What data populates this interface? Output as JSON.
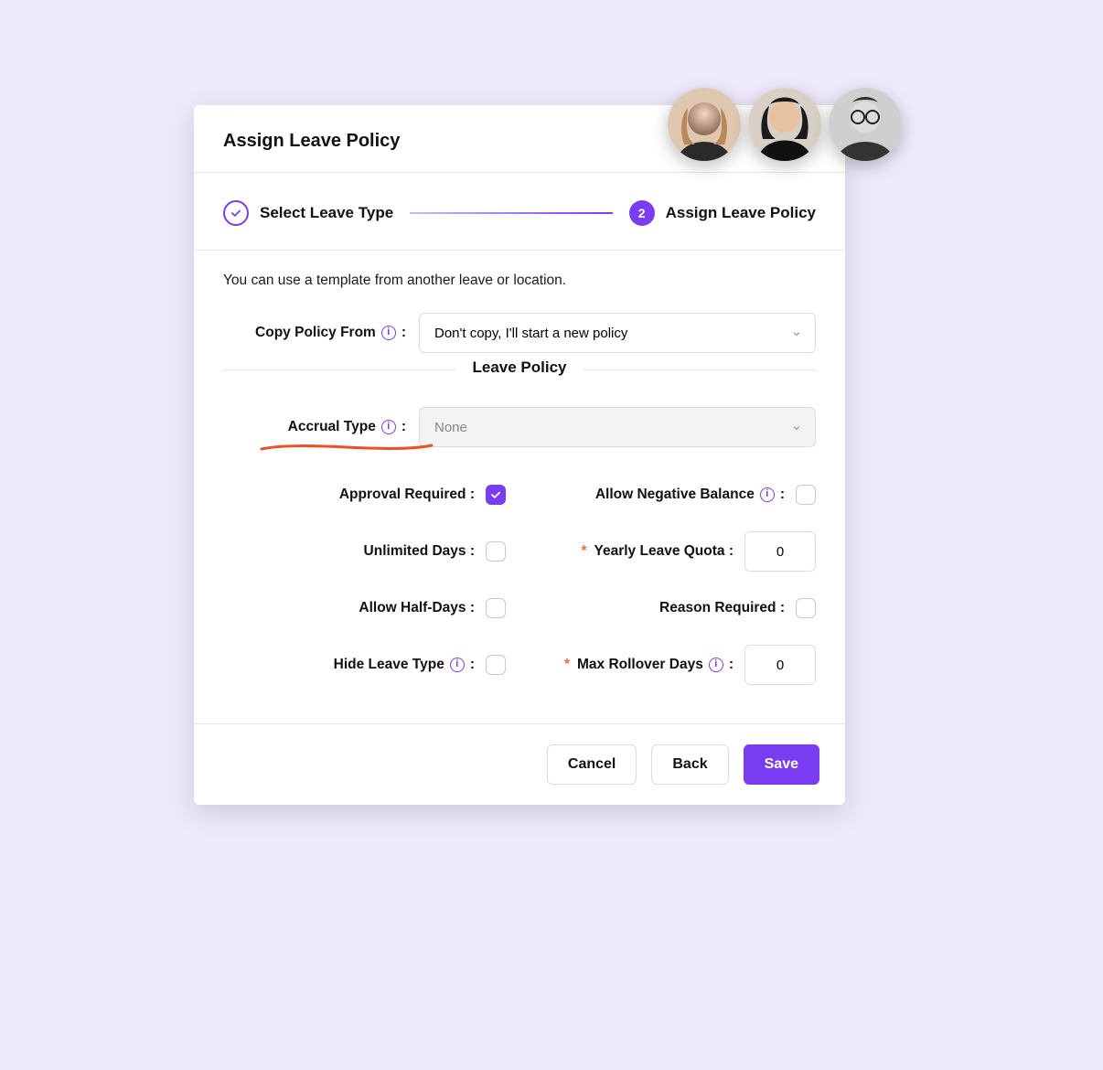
{
  "dialog": {
    "title": "Assign Leave Policy"
  },
  "steps": {
    "step1_label": "Select Leave Type",
    "step2_number": "2",
    "step2_label": "Assign Leave Policy"
  },
  "intro": "You can use a template from another leave or location.",
  "copy_from": {
    "label": "Copy Policy From",
    "value": "Don't copy, I'll start a new policy"
  },
  "section_title": "Leave Policy",
  "accrual": {
    "label": "Accrual Type",
    "value": "None"
  },
  "fields": {
    "approval_required": {
      "label": "Approval Required :",
      "checked": true
    },
    "allow_negative": {
      "label": "Allow Negative Balance",
      "checked": false
    },
    "unlimited_days": {
      "label": "Unlimited Days :",
      "checked": false
    },
    "yearly_quota": {
      "label": "Yearly Leave Quota :",
      "value": "0",
      "required": true
    },
    "allow_half_days": {
      "label": "Allow Half-Days :",
      "checked": false
    },
    "reason_required": {
      "label": "Reason Required :",
      "checked": false
    },
    "hide_leave_type": {
      "label": "Hide Leave Type",
      "checked": false
    },
    "max_rollover": {
      "label": "Max Rollover Days",
      "value": "0",
      "required": true
    }
  },
  "footer": {
    "cancel": "Cancel",
    "back": "Back",
    "save": "Save"
  },
  "avatars": [
    "avatar-1",
    "avatar-2",
    "avatar-3"
  ]
}
